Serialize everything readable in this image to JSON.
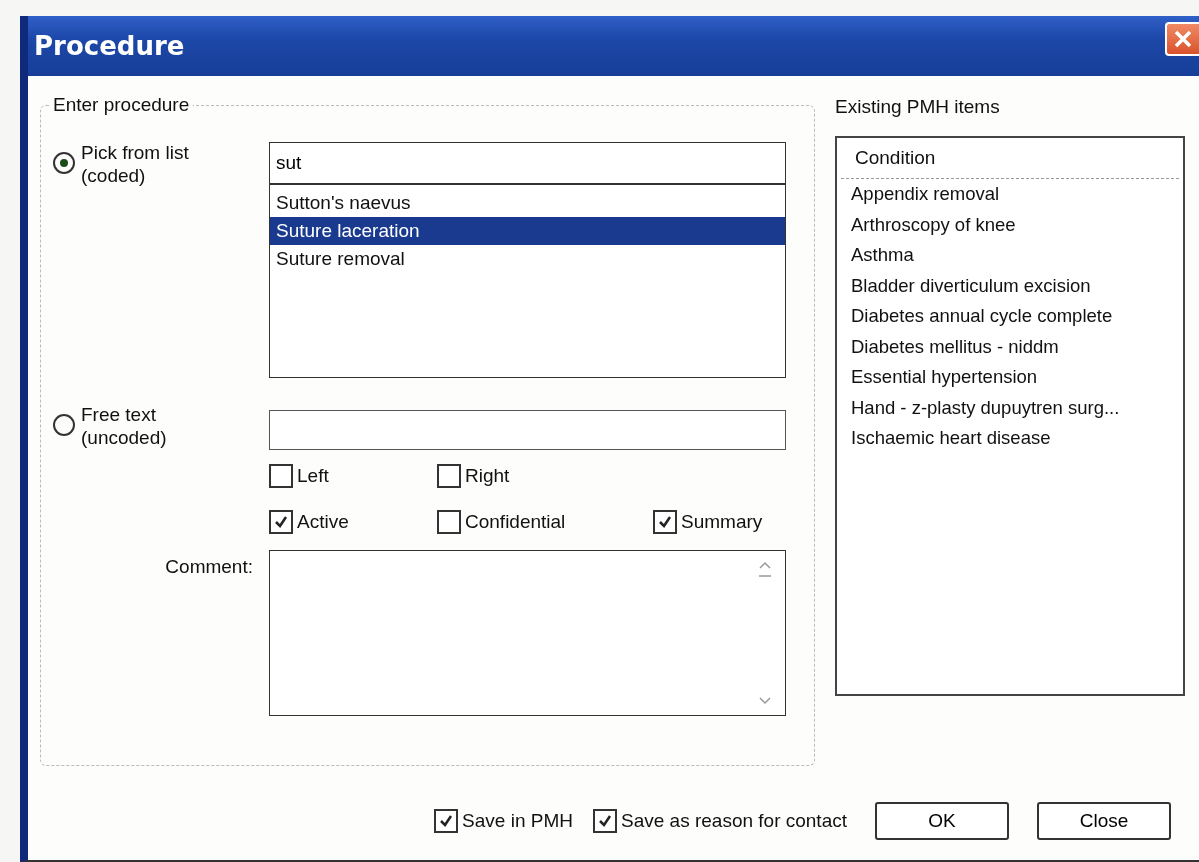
{
  "window": {
    "title": "Procedure"
  },
  "procedure_group": {
    "title": "Enter procedure",
    "pick_option": {
      "label": "Pick from list\n(coded)",
      "selected": true
    },
    "search_field": {
      "value": "sut"
    },
    "results": [
      {
        "label": "Sutton's naevus",
        "selected": false
      },
      {
        "label": "Suture laceration",
        "selected": true
      },
      {
        "label": "Suture removal",
        "selected": false
      }
    ],
    "free_option": {
      "label": "Free text\n(uncoded)",
      "selected": false
    },
    "checkbox_rows": [
      [
        {
          "label": "Left",
          "checked": false
        },
        {
          "label": "Right",
          "checked": false
        }
      ],
      [
        {
          "label": "Active",
          "checked": true
        },
        {
          "label": "Confidential",
          "checked": false
        },
        {
          "label": "Summary",
          "checked": true
        }
      ]
    ],
    "comment_label": "Comment:"
  },
  "pmh_panel": {
    "title": "Existing PMH items",
    "column": "Condition",
    "items": [
      "Appendix removal",
      "Arthroscopy of knee",
      "Asthma",
      "Bladder diverticulum excision",
      "Diabetes annual cycle complete",
      "Diabetes mellitus - niddm",
      "Essential hypertension",
      "Hand - z-plasty dupuytren surg...",
      "Ischaemic heart disease"
    ]
  },
  "footer": {
    "checkboxes": [
      {
        "label": "Save in PMH",
        "checked": true
      },
      {
        "label": "Save as reason for contact",
        "checked": true
      }
    ],
    "buttons": [
      "OK",
      "Close"
    ]
  }
}
